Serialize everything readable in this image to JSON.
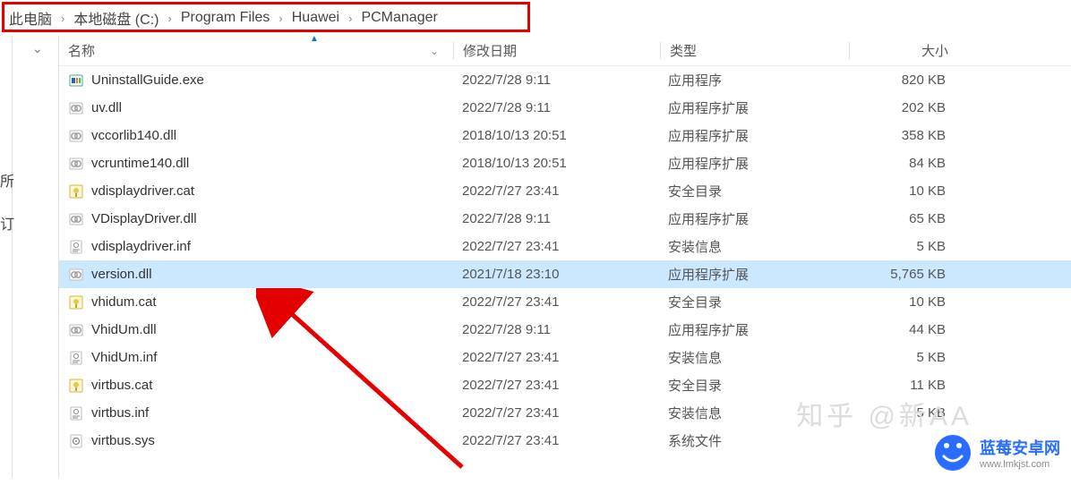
{
  "breadcrumb": {
    "items": [
      "此电脑",
      "本地磁盘 (C:)",
      "Program Files",
      "Huawei",
      "PCManager"
    ]
  },
  "left_fragments": {
    "a": "所",
    "b": "订"
  },
  "columns": {
    "name": "名称",
    "date": "修改日期",
    "type": "类型",
    "size": "大小"
  },
  "selected_index": 7,
  "files": [
    {
      "icon": "exe",
      "name": "UninstallGuide.exe",
      "date": "2022/7/28 9:11",
      "type": "应用程序",
      "size": "820 KB"
    },
    {
      "icon": "dll",
      "name": "uv.dll",
      "date": "2022/7/28 9:11",
      "type": "应用程序扩展",
      "size": "202 KB"
    },
    {
      "icon": "dll",
      "name": "vccorlib140.dll",
      "date": "2018/10/13 20:51",
      "type": "应用程序扩展",
      "size": "358 KB"
    },
    {
      "icon": "dll",
      "name": "vcruntime140.dll",
      "date": "2018/10/13 20:51",
      "type": "应用程序扩展",
      "size": "84 KB"
    },
    {
      "icon": "cat",
      "name": "vdisplaydriver.cat",
      "date": "2022/7/27 23:41",
      "type": "安全目录",
      "size": "10 KB"
    },
    {
      "icon": "dll",
      "name": "VDisplayDriver.dll",
      "date": "2022/7/28 9:11",
      "type": "应用程序扩展",
      "size": "65 KB"
    },
    {
      "icon": "inf",
      "name": "vdisplaydriver.inf",
      "date": "2022/7/27 23:41",
      "type": "安装信息",
      "size": "5 KB"
    },
    {
      "icon": "dll",
      "name": "version.dll",
      "date": "2021/7/18 23:10",
      "type": "应用程序扩展",
      "size": "5,765 KB"
    },
    {
      "icon": "cat",
      "name": "vhidum.cat",
      "date": "2022/7/27 23:41",
      "type": "安全目录",
      "size": "10 KB"
    },
    {
      "icon": "dll",
      "name": "VhidUm.dll",
      "date": "2022/7/28 9:11",
      "type": "应用程序扩展",
      "size": "44 KB"
    },
    {
      "icon": "inf",
      "name": "VhidUm.inf",
      "date": "2022/7/27 23:41",
      "type": "安装信息",
      "size": "5 KB"
    },
    {
      "icon": "cat",
      "name": "virtbus.cat",
      "date": "2022/7/27 23:41",
      "type": "安全目录",
      "size": "11 KB"
    },
    {
      "icon": "inf",
      "name": "virtbus.inf",
      "date": "2022/7/27 23:41",
      "type": "安装信息",
      "size": "5 KB"
    },
    {
      "icon": "sys",
      "name": "virtbus.sys",
      "date": "2022/7/27 23:41",
      "type": "系统文件",
      "size": ""
    }
  ],
  "watermark": {
    "brand": "蓝莓安卓网",
    "url": "www.lmkjst.com"
  }
}
